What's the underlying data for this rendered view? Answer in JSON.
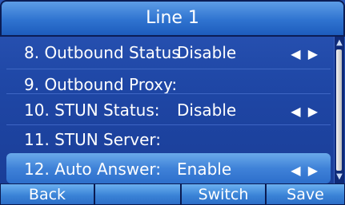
{
  "header": {
    "title": "Line 1"
  },
  "rows": [
    {
      "label": "8. Outbound Status",
      "value": "Disable",
      "has_arrows": true,
      "selected": false
    },
    {
      "label": "9. Outbound Proxy:",
      "value": "",
      "has_arrows": false,
      "selected": false
    },
    {
      "label": "10. STUN Status:",
      "value": "Disable",
      "has_arrows": true,
      "selected": false
    },
    {
      "label": "11. STUN Server:",
      "value": "",
      "has_arrows": false,
      "selected": false
    },
    {
      "label": "12. Auto Answer:",
      "value": "Enable",
      "has_arrows": true,
      "selected": true
    }
  ],
  "arrows_glyph": "◀ ▶",
  "softkeys": {
    "back": "Back",
    "empty": "",
    "switch": "Switch",
    "save": "Save"
  },
  "scrollbar": {
    "up_icon": "▲",
    "down_icon": "▼"
  },
  "colors": {
    "background": "#1f47a6",
    "header": "#2f73d0",
    "selected_row": "#3f82d8",
    "text": "#ffffff"
  }
}
